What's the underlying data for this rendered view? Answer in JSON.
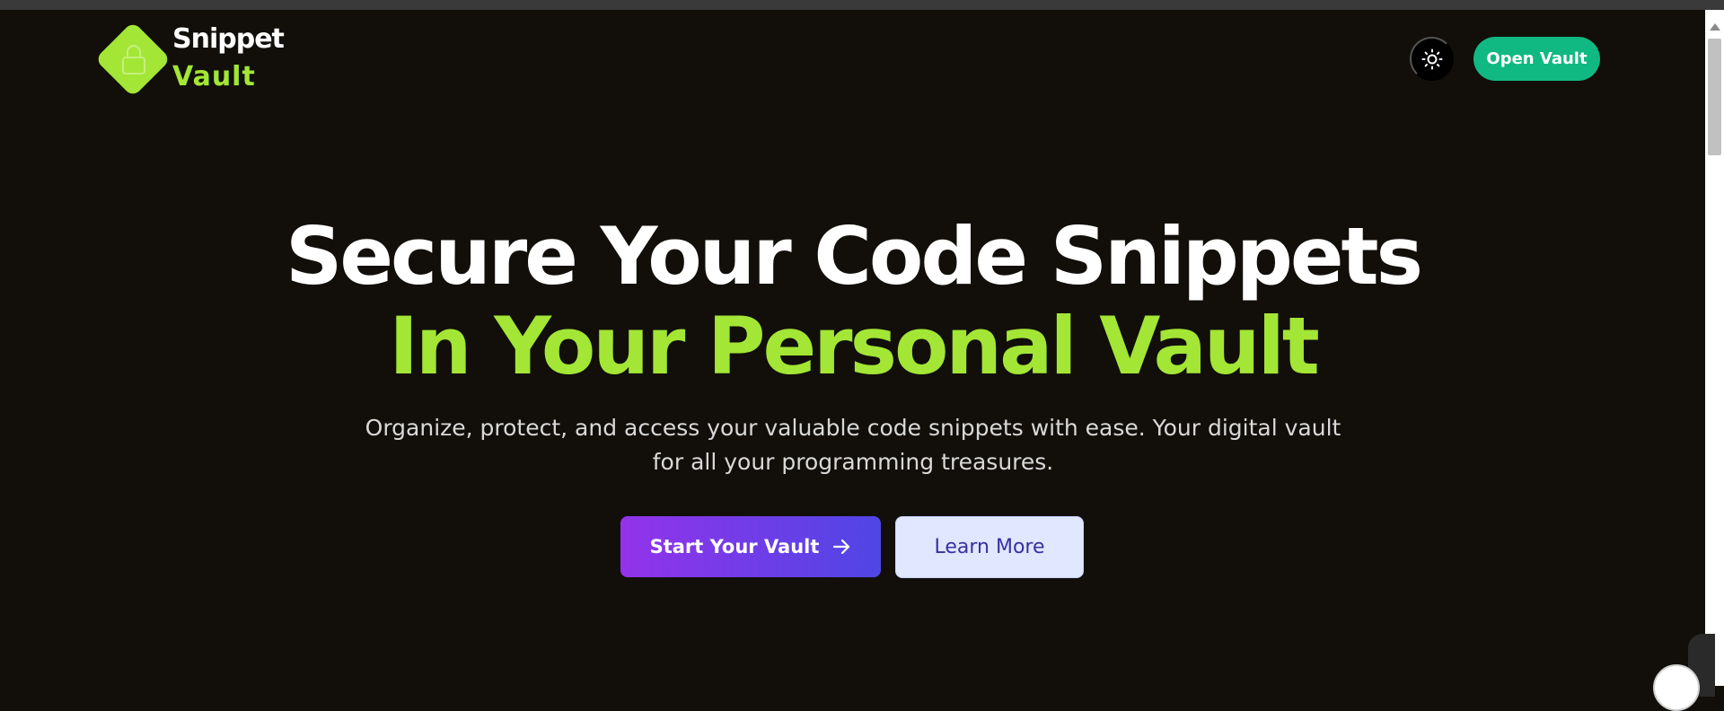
{
  "brand": {
    "line1": "Snippet",
    "line2": "Vault",
    "icon": "lock-icon",
    "accent_color": "#a3e635"
  },
  "header": {
    "theme_toggle_icon": "sun-icon",
    "open_vault_label": "Open Vault",
    "open_vault_color": "#10b981"
  },
  "hero": {
    "title_line1": "Secure Your Code Snippets",
    "title_line2": "In Your Personal Vault",
    "subtitle": "Organize, protect, and access your valuable code snippets with ease. Your digital vault for all your programming treasures.",
    "primary_cta": "Start Your Vault",
    "primary_cta_icon": "arrow-right-icon",
    "secondary_cta": "Learn More"
  },
  "colors": {
    "background": "#120f0b",
    "primary_gradient_start": "#9333ea",
    "primary_gradient_end": "#4f46e5"
  }
}
